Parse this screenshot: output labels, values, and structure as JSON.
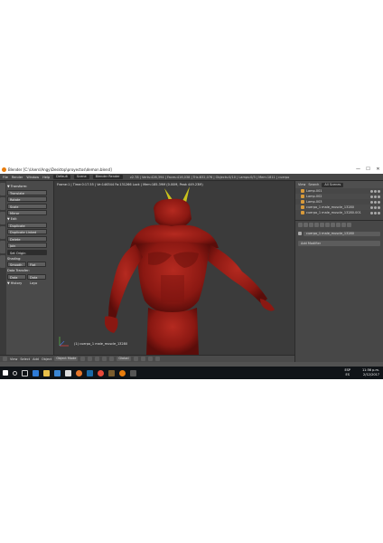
{
  "window": {
    "title": "Blender [C:\\Users\\Angy\\Desktop\\proyectos\\demon.blend]",
    "close_glyph": "✕",
    "minimize_glyph": "—",
    "maximize_glyph": "☐"
  },
  "info_header": {
    "menus": [
      "File",
      "Render",
      "Window",
      "Help"
    ],
    "layout": "Default",
    "scene": "Scene",
    "engine": "Blender Render",
    "stats": "v2.78 | Verts:426,394 | Faces:416,038 | Tris:832,076 | Objects:0/10 | Lamps:0/3 | Mem:1811 | cuerpo"
  },
  "tool_shelf": {
    "transform_title": "▼ Transform:",
    "transform_buttons": [
      "Translate",
      "Rotate",
      "Scale",
      "Mirror"
    ],
    "edit_title": "▼ Edit",
    "edit_buttons": [
      "Duplicate",
      "Duplicate Linked",
      "Delete",
      "Join"
    ],
    "set_origin": "Set Origin",
    "shading_title": "Shading:",
    "shading_buttons": [
      "Smooth",
      "Flat"
    ],
    "data_transfer_title": "Data Transfer:",
    "data_buttons": [
      "Data",
      "Data Layo"
    ],
    "history_title": "▼ History"
  },
  "viewport": {
    "info": "Frame:1 | Time:0:17.55 | Ve:146344 Fa:131266 Lock | Mem:185.39M (0.00M, Peak 449.23M)",
    "object_label": "(1) cuerpo_1 male_muscle_13280",
    "skin_color": "#9a1a14",
    "horn_color": "#c9c21c"
  },
  "viewport_header": {
    "menus": [
      "View",
      "Select",
      "Add",
      "Object"
    ],
    "mode": "Object Mode",
    "pivot": "Global"
  },
  "timeline": {
    "menus": [
      "View",
      "Marker",
      "Frame",
      "Playback"
    ],
    "start_label": "Start:",
    "start_value": "1",
    "end_label": "End:",
    "end_value": "250",
    "current_frame": "1",
    "sync": "No Sync"
  },
  "outliner": {
    "menus": [
      "View",
      "Search"
    ],
    "filter": "All Scenes",
    "items": [
      "Lamp.001",
      "Lamp.002",
      "Lamp.003",
      "cuerpo_1 male_muscle_13280",
      "cuerpo_1 male_muscle_13280.001",
      "cuerpo_1 male_muscle_13280.002",
      "cuerpo_1 male_muscle_13280.003"
    ]
  },
  "properties": {
    "object_name": "cuerpo_1 male_muscle_13280",
    "add_modifier": "Add Modifier"
  },
  "taskbar": {
    "lang_top": "ESP",
    "lang_bottom": "ES",
    "time": "11:56 p.m.",
    "date": "2/12/2017"
  }
}
